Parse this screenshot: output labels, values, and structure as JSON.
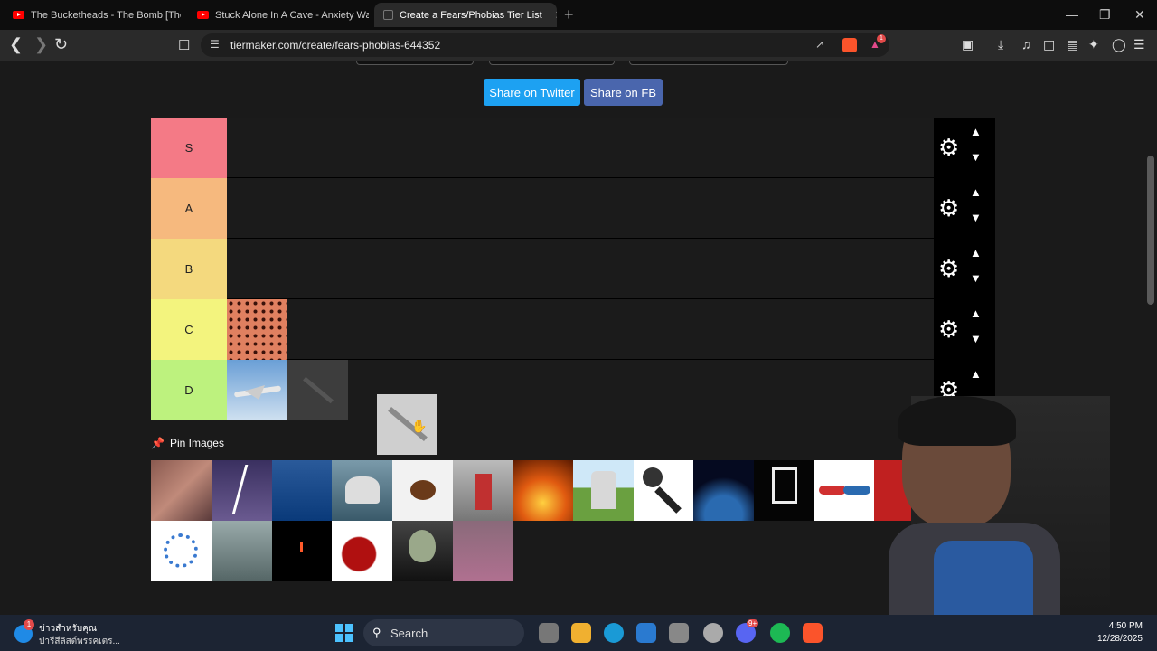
{
  "browser": {
    "tabs": [
      {
        "title": "The Bucketheads - The Bomb [These",
        "active": false
      },
      {
        "title": "Stuck Alone In A Cave - Anxiety Warr",
        "active": false
      },
      {
        "title": "Create a Fears/Phobias Tier List",
        "active": true
      }
    ],
    "url": "tiermaker.com/create/fears-phobias-644352",
    "new_tab": "+",
    "tab_close": "✕",
    "brave_badge": "1"
  },
  "page": {
    "share_twitter": "Share on Twitter",
    "share_fb": "Share on FB",
    "tiers": [
      {
        "label": "S",
        "color": "#ff7f7f"
      },
      {
        "label": "A",
        "color": "#ffbf7f"
      },
      {
        "label": "B",
        "color": "#ffdf7f"
      },
      {
        "label": "C",
        "color": "#ffff7f"
      },
      {
        "label": "D",
        "color": "#bfff7f"
      }
    ],
    "pin_images": "Pin Images"
  },
  "taskbar": {
    "news_badge": "1",
    "news_title": "ข่าวสำหรับคุณ",
    "news_subtitle": "ปารีสีลิสต์พรรคเตร...",
    "search_label": "Search",
    "time": "4:50 PM",
    "date": "12/28/2025",
    "discord_badge": "9+"
  }
}
